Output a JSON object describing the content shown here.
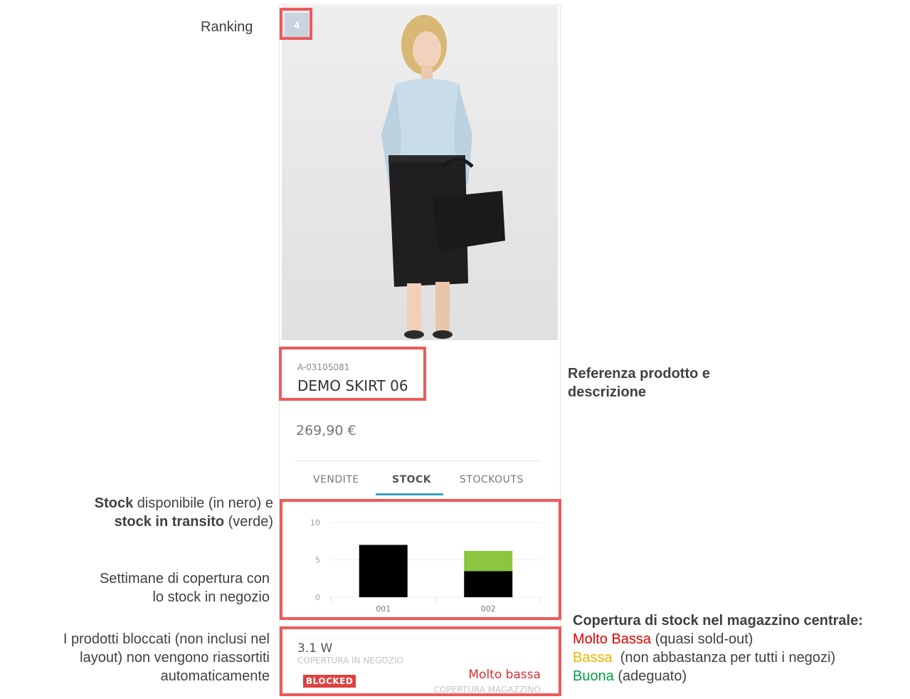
{
  "annotations": {
    "ranking": "Ranking",
    "product_ref_line1": "Referenza prodotto e",
    "product_ref_line2": "descrizione",
    "stock_bold1": "Stock",
    "stock_text1": " disponibile (in nero) e",
    "stock_bold2": "stock in transito",
    "stock_text2": " (verde)",
    "coverage_line1": "Settimane di copertura con",
    "coverage_line2": "lo stock in negozio",
    "blocked_line1": "I prodotti bloccati (non inclusi nel",
    "blocked_line2": "layout) non vengono riassortiti",
    "blocked_line3": "automaticamente",
    "warehouse_title": "Copertura di stock nel magazzino centrale:",
    "legend": [
      {
        "label": "Molto Bassa",
        "note": " (quasi sold-out)",
        "color": "#e00000"
      },
      {
        "label": "Bassa",
        "note": "  (non abbastanza per tutti i negozi)",
        "color": "#f0b400"
      },
      {
        "label": "Buona",
        "note": " (adeguato)",
        "color": "#00a040"
      }
    ]
  },
  "product": {
    "rank": "4",
    "reference": "A-03105081",
    "description": "DEMO SKIRT 06",
    "price": "269,90 €"
  },
  "tabs": [
    {
      "label": "VENDITE",
      "active": false
    },
    {
      "label": "STOCK",
      "active": true
    },
    {
      "label": "STOCKOUTS",
      "active": false
    }
  ],
  "chart_data": {
    "type": "bar",
    "categories": [
      "001",
      "002"
    ],
    "series": [
      {
        "values": [
          7,
          3.5
        ],
        "color": "#000000"
      },
      {
        "values": [
          0,
          2.7
        ],
        "color": "#8cc63f"
      }
    ],
    "stacked": true,
    "ylim": [
      0,
      10
    ],
    "yticks": [
      0,
      5,
      10
    ],
    "grid": true
  },
  "coverage": {
    "store_value": "3.1 W",
    "store_label": "COPERTURA IN NEGOZIO",
    "blocked_badge": "BLOCKED",
    "warehouse_status": "Molto bassa",
    "warehouse_label": "COPERTURA MAGAZZINO"
  },
  "colors": {
    "highlight": "#ee5a5a",
    "tab_active_underline": "#3aa3c8",
    "stock_available": "#000000",
    "stock_in_transit": "#8cc63f"
  }
}
